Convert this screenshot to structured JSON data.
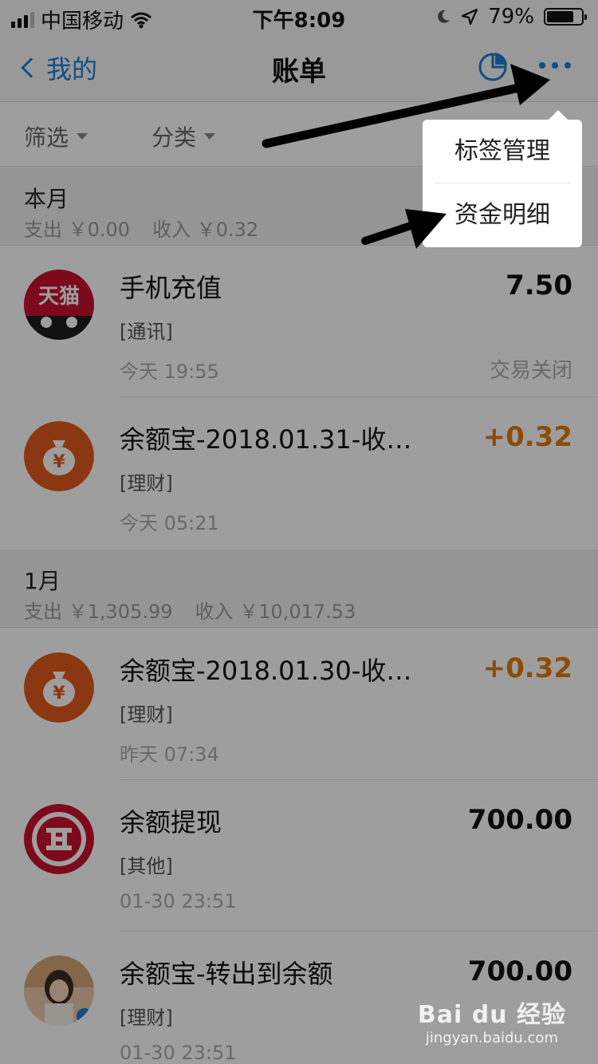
{
  "status_bar": {
    "carrier": "中国移动",
    "time": "下午8:09",
    "battery": "79%"
  },
  "nav": {
    "back_label": "我的",
    "title": "账单"
  },
  "filters": [
    {
      "label": "筛选"
    },
    {
      "label": "分类"
    }
  ],
  "menu": {
    "items": [
      {
        "label": "标签管理"
      },
      {
        "label": "资金明细"
      }
    ]
  },
  "sections": [
    {
      "title": "本月",
      "expense_label": "支出",
      "expense": "￥0.00",
      "income_label": "收入",
      "income": "￥0.32",
      "items": [
        {
          "icon": "tmall-icon",
          "title": "手机充值",
          "category": "[通讯]",
          "time": "今天  19:55",
          "amount": "7.50",
          "status": "交易关闭"
        },
        {
          "icon": "yuebao-icon",
          "title": "余额宝-2018.01.31-收…",
          "category": "[理财]",
          "time": "今天  05:21",
          "amount": "+0.32",
          "status": ""
        }
      ]
    },
    {
      "title": "1月",
      "expense_label": "支出",
      "expense": "￥1,305.99",
      "income_label": "收入",
      "income": "￥10,017.53",
      "items": [
        {
          "icon": "yuebao-icon",
          "title": "余额宝-2018.01.30-收…",
          "category": "[理财]",
          "time": "昨天  07:34",
          "amount": "+0.32",
          "status": ""
        },
        {
          "icon": "icbc-icon",
          "title": "余额提现",
          "category": "[其他]",
          "time": "01-30  23:51",
          "amount": "700.00",
          "status": ""
        },
        {
          "icon": "user-avatar",
          "title": "余额宝-转出到余额",
          "category": "[理财]",
          "time": "01-30  23:51",
          "amount": "700.00",
          "status": ""
        }
      ]
    }
  ],
  "watermark": {
    "logo": "Bai du 经验",
    "url": "jingyan.baidu.com"
  },
  "colors": {
    "accent": "#1a7fd4",
    "income": "#e07b10",
    "tmall_red": "#c8102e",
    "yuebao_orange": "#e05a1e",
    "icbc_red": "#c8102e"
  }
}
